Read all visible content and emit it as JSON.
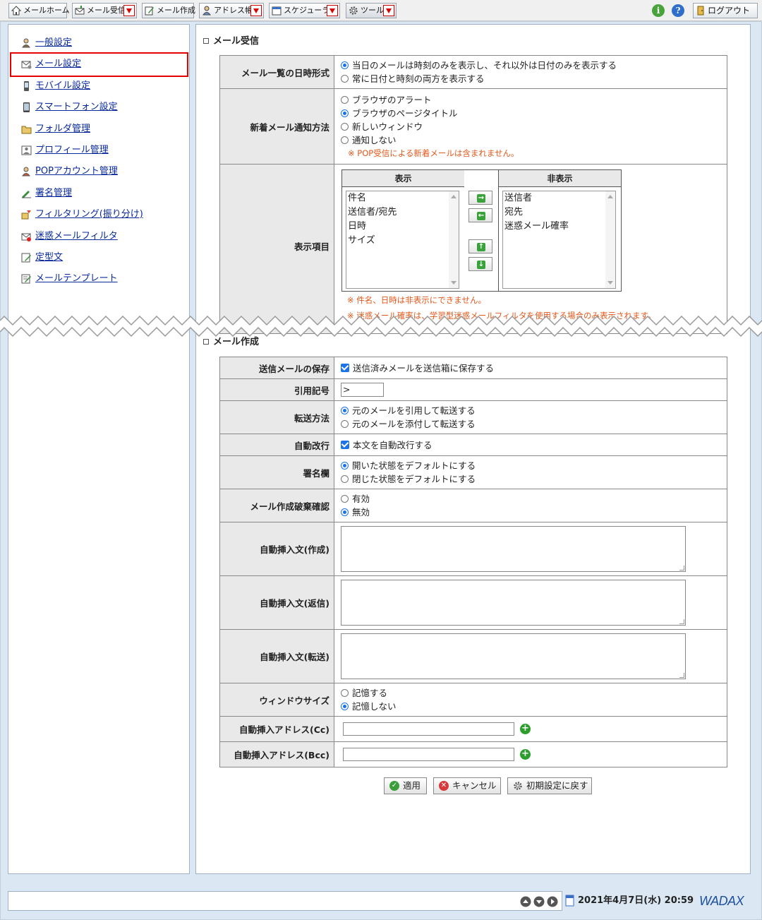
{
  "toolbar": {
    "items": [
      {
        "label": "メールホーム",
        "icon": "home-icon",
        "dropdown": false
      },
      {
        "label": "メール受信",
        "icon": "mail-receive-icon",
        "dropdown": true
      },
      {
        "label": "メール作成",
        "icon": "mail-compose-icon",
        "dropdown": false
      },
      {
        "label": "アドレス帳",
        "icon": "address-book-icon",
        "dropdown": true
      },
      {
        "label": "スケジューラ",
        "icon": "calendar-icon",
        "dropdown": true
      },
      {
        "label": "ツール",
        "icon": "gear-icon",
        "dropdown": true
      }
    ],
    "logout": "ログアウト"
  },
  "sidebar": {
    "items": [
      {
        "label": "一般設定",
        "icon": "user-settings-icon",
        "selected": false
      },
      {
        "label": "メール設定",
        "icon": "mail-settings-icon",
        "selected": true
      },
      {
        "label": "モバイル設定",
        "icon": "mobile-icon",
        "selected": false
      },
      {
        "label": "スマートフォン設定",
        "icon": "smartphone-icon",
        "selected": false
      },
      {
        "label": "フォルダ管理",
        "icon": "folder-icon",
        "selected": false
      },
      {
        "label": "プロフィール管理",
        "icon": "profile-icon",
        "selected": false
      },
      {
        "label": "POPアカウント管理",
        "icon": "pop-account-icon",
        "selected": false
      },
      {
        "label": "署名管理",
        "icon": "signature-icon",
        "selected": false
      },
      {
        "label": "フィルタリング(振り分け)",
        "icon": "filter-icon",
        "selected": false
      },
      {
        "label": "迷惑メールフィルタ",
        "icon": "spam-filter-icon",
        "selected": false
      },
      {
        "label": "定型文",
        "icon": "template-text-icon",
        "selected": false
      },
      {
        "label": "メールテンプレート",
        "icon": "mail-template-icon",
        "selected": false
      }
    ]
  },
  "receive": {
    "title": "メール受信",
    "date_format": {
      "label": "メール一覧の日時形式",
      "options": [
        "当日のメールは時刻のみを表示し、それ以外は日付のみを表示する",
        "常に日付と時刻の両方を表示する"
      ],
      "selected": 0
    },
    "notify": {
      "label": "新着メール通知方法",
      "options": [
        "ブラウザのアラート",
        "ブラウザのページタイトル",
        "新しいウィンドウ",
        "通知しない"
      ],
      "selected": 1,
      "note": "※ POP受信による新着メールは含まれません。"
    },
    "display_items": {
      "label": "表示項目",
      "shown_header": "表示",
      "hidden_header": "非表示",
      "shown": [
        "件名",
        "送信者/宛先",
        "日時",
        "サイズ"
      ],
      "hidden": [
        "送信者",
        "宛先",
        "迷惑メール確率"
      ],
      "note1": "※ 件名、日時は非表示にできません。",
      "note2": "※ 迷惑メール確率は、学習型迷惑メールフィルタを使用する場合のみ表示されます。"
    }
  },
  "compose": {
    "title": "メール作成",
    "save_sent": {
      "label": "送信メールの保存",
      "text": "送信済みメールを送信箱に保存する",
      "checked": true
    },
    "quote_mark": {
      "label": "引用記号",
      "value": ">"
    },
    "forward": {
      "label": "転送方法",
      "options": [
        "元のメールを引用して転送する",
        "元のメールを添付して転送する"
      ],
      "selected": 0
    },
    "auto_wrap": {
      "label": "自動改行",
      "text": "本文を自動改行する",
      "checked": true
    },
    "signature": {
      "label": "署名欄",
      "options": [
        "開いた状態をデフォルトにする",
        "閉じた状態をデフォルトにする"
      ],
      "selected": 0
    },
    "discard_confirm": {
      "label": "メール作成破棄確認",
      "options": [
        "有効",
        "無効"
      ],
      "selected": 1
    },
    "auto_insert_create": {
      "label": "自動挿入文(作成)",
      "value": ""
    },
    "auto_insert_reply": {
      "label": "自動挿入文(返信)",
      "value": ""
    },
    "auto_insert_forward": {
      "label": "自動挿入文(転送)",
      "value": ""
    },
    "window_size": {
      "label": "ウィンドウサイズ",
      "options": [
        "記憶する",
        "記憶しない"
      ],
      "selected": 1
    },
    "auto_cc": {
      "label": "自動挿入アドレス(Cc)",
      "value": ""
    },
    "auto_bcc": {
      "label": "自動挿入アドレス(Bcc)",
      "value": ""
    }
  },
  "actions": {
    "apply": "適用",
    "cancel": "キャンセル",
    "reset": "初期設定に戻す"
  },
  "footer": {
    "datetime": "2021年4月7日(水) 20:59",
    "brand": "WADAX"
  }
}
